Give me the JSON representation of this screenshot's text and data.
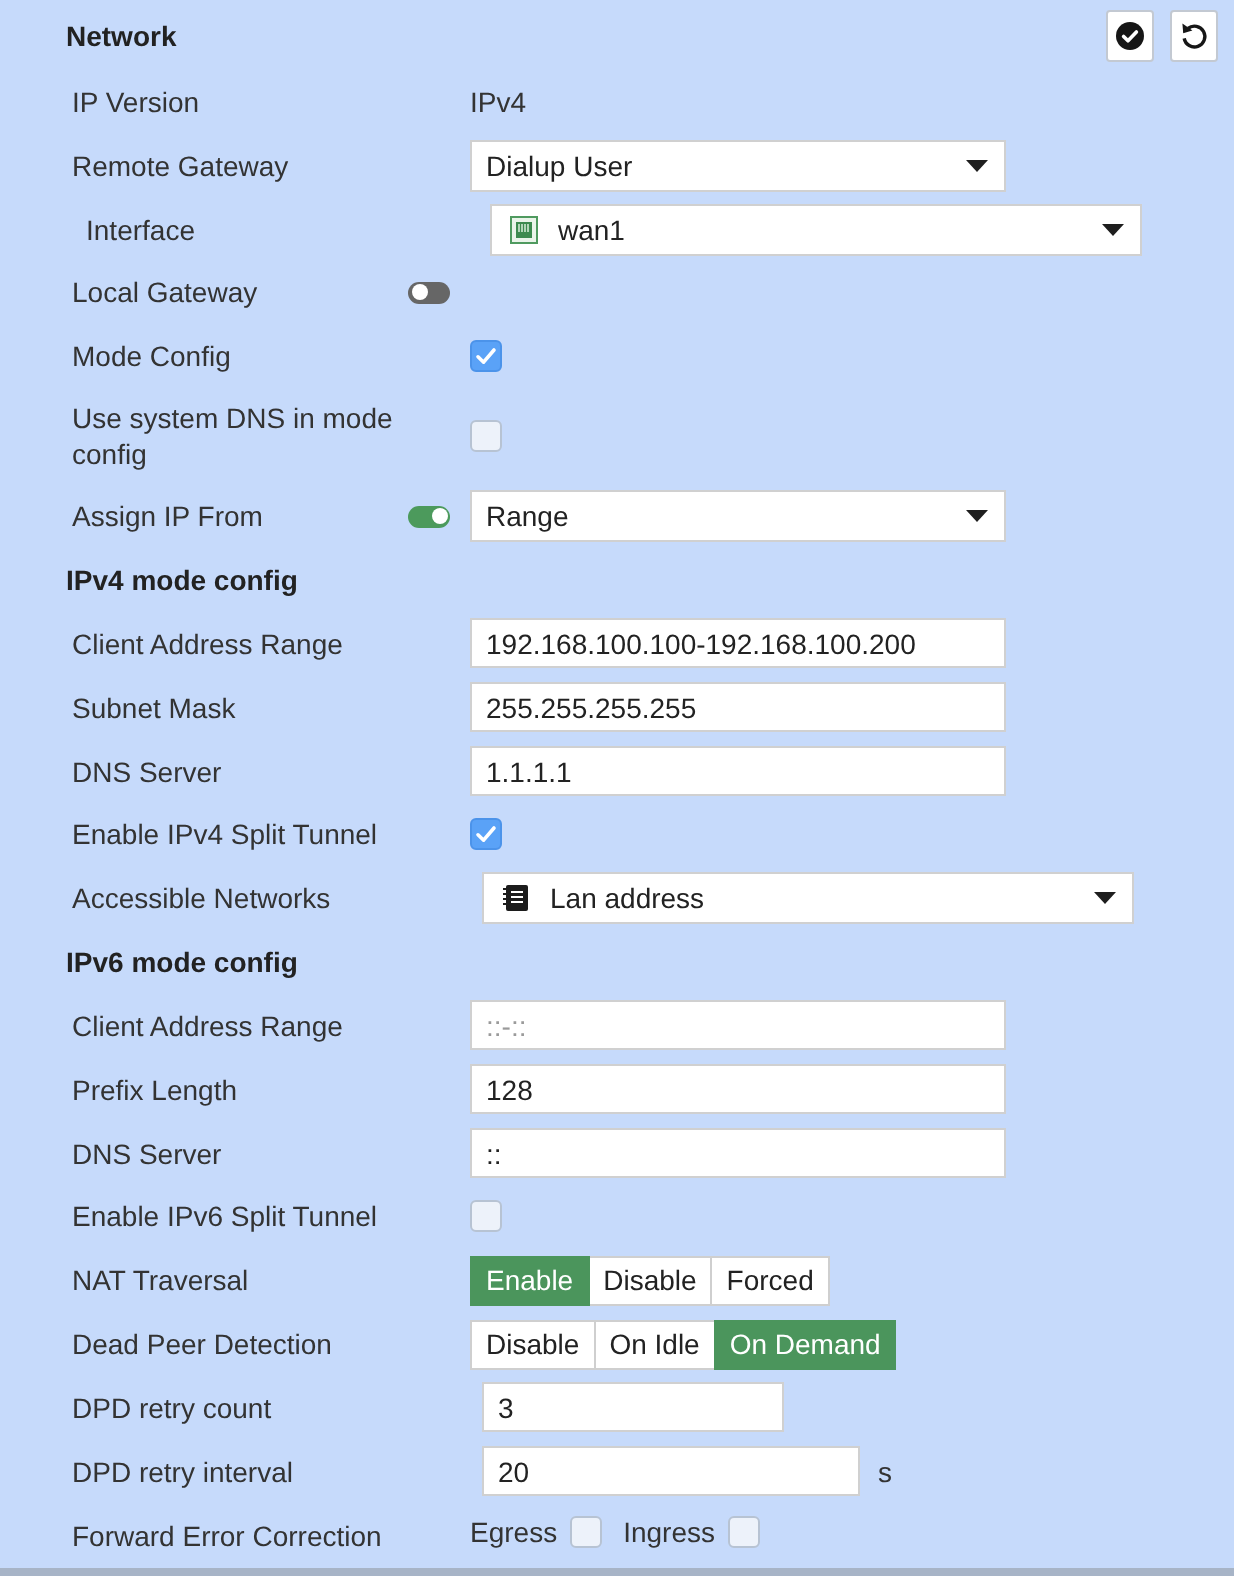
{
  "panel": {
    "title": "Network"
  },
  "rows": [
    {
      "kind": "text",
      "label": "IP Version",
      "value": "IPv4"
    },
    {
      "kind": "select",
      "label": "Remote Gateway",
      "value": "Dialup User",
      "children": [
        {
          "kind": "interface_select",
          "label": "Interface",
          "value": "wan1"
        }
      ]
    },
    {
      "kind": "toggle",
      "label": "Local Gateway",
      "on": false
    },
    {
      "kind": "checkbox",
      "label": "Mode Config",
      "checked": true
    },
    {
      "kind": "checkbox",
      "label": "Use system DNS in mode config",
      "checked": false
    },
    {
      "kind": "toggle_select",
      "label": "Assign IP From",
      "on": true,
      "value": "Range"
    },
    {
      "kind": "heading",
      "label": "IPv4 mode config"
    },
    {
      "kind": "input",
      "label": "Client Address Range",
      "value": "192.168.100.100-192.168.100.200"
    },
    {
      "kind": "input",
      "label": "Subnet Mask",
      "value": "255.255.255.255"
    },
    {
      "kind": "input",
      "label": "DNS Server",
      "value": "1.1.1.1"
    },
    {
      "kind": "checkbox",
      "label": "Enable IPv4 Split Tunnel",
      "checked": true
    },
    {
      "kind": "address_select",
      "label": "Accessible Networks",
      "value": "Lan address"
    },
    {
      "kind": "heading",
      "label": "IPv6 mode config"
    },
    {
      "kind": "input",
      "label": "Client Address Range",
      "placeholder": "::-::"
    },
    {
      "kind": "input",
      "label": "Prefix Length",
      "value": "128"
    },
    {
      "kind": "input",
      "label": "DNS Server",
      "value": "::"
    },
    {
      "kind": "checkbox",
      "label": "Enable IPv6 Split Tunnel",
      "checked": false
    },
    {
      "kind": "segmented",
      "label": "NAT Traversal",
      "options": [
        {
          "label": "Enable",
          "selected": true
        },
        {
          "label": "Disable",
          "selected": false
        },
        {
          "label": "Forced",
          "selected": false
        }
      ]
    },
    {
      "kind": "segmented",
      "label": "Dead Peer Detection",
      "options": [
        {
          "label": "Disable",
          "selected": false
        },
        {
          "label": "On Idle",
          "selected": false
        },
        {
          "label": "On Demand",
          "selected": true
        }
      ]
    },
    {
      "kind": "number",
      "label": "DPD retry count",
      "value": "3"
    },
    {
      "kind": "number",
      "label": "DPD retry interval",
      "value": "20",
      "unit": "s"
    },
    {
      "kind": "checkbox_group",
      "label": "Forward Error Correction",
      "items": [
        {
          "label": "Egress",
          "checked": false
        },
        {
          "label": "Ingress",
          "checked": false
        }
      ]
    }
  ]
}
